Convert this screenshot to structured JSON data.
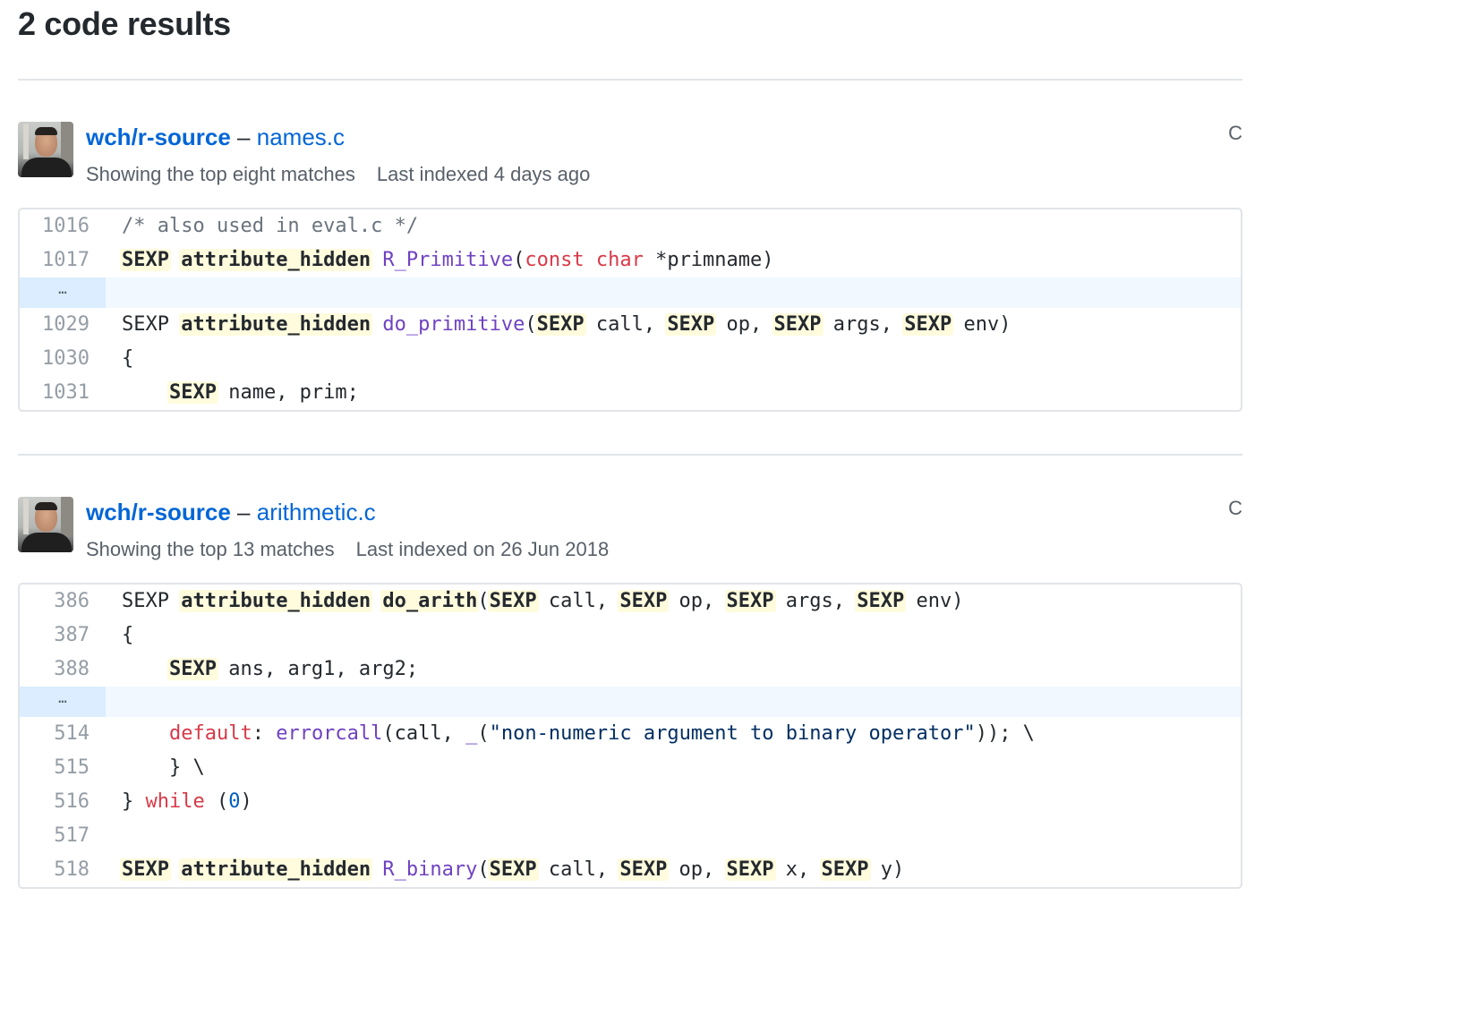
{
  "page": {
    "title": "2 code results"
  },
  "results": [
    {
      "repo": "wch/r-source",
      "separator": " – ",
      "file": "names.c",
      "language": "C",
      "matches_text": "Showing the top eight matches",
      "indexed_text": "Last indexed 4 days ago",
      "lines": [
        {
          "num": "1016",
          "tokens": [
            {
              "t": "/* also used in eval.c */",
              "c": "cm"
            }
          ]
        },
        {
          "num": "1017",
          "tokens": [
            {
              "t": "SEXP",
              "c": "hl"
            },
            {
              "t": " ",
              "c": ""
            },
            {
              "t": "attribute_hidden",
              "c": "hl"
            },
            {
              "t": " ",
              "c": ""
            },
            {
              "t": "R_Primitive",
              "c": "en"
            },
            {
              "t": "(",
              "c": ""
            },
            {
              "t": "const",
              "c": "k"
            },
            {
              "t": " ",
              "c": ""
            },
            {
              "t": "char",
              "c": "k"
            },
            {
              "t": " *primname)",
              "c": ""
            }
          ]
        },
        {
          "expander": true,
          "symbol": "…"
        },
        {
          "num": "1029",
          "tokens": [
            {
              "t": "SEXP ",
              "c": ""
            },
            {
              "t": "attribute_hidden",
              "c": "hl"
            },
            {
              "t": " ",
              "c": ""
            },
            {
              "t": "do_primitive",
              "c": "en"
            },
            {
              "t": "(",
              "c": ""
            },
            {
              "t": "SEXP",
              "c": "hl"
            },
            {
              "t": " call, ",
              "c": ""
            },
            {
              "t": "SEXP",
              "c": "hl"
            },
            {
              "t": " op, ",
              "c": ""
            },
            {
              "t": "SEXP",
              "c": "hl"
            },
            {
              "t": " args, ",
              "c": ""
            },
            {
              "t": "SEXP",
              "c": "hl"
            },
            {
              "t": " env)",
              "c": ""
            }
          ]
        },
        {
          "num": "1030",
          "tokens": [
            {
              "t": "{",
              "c": ""
            }
          ]
        },
        {
          "num": "1031",
          "tokens": [
            {
              "t": "    ",
              "c": ""
            },
            {
              "t": "SEXP",
              "c": "hl"
            },
            {
              "t": " name, prim;",
              "c": ""
            }
          ]
        }
      ]
    },
    {
      "repo": "wch/r-source",
      "separator": " – ",
      "file": "arithmetic.c",
      "language": "C",
      "matches_text": "Showing the top 13 matches",
      "indexed_text": "Last indexed on 26 Jun 2018",
      "lines": [
        {
          "num": "386",
          "tokens": [
            {
              "t": "SEXP ",
              "c": ""
            },
            {
              "t": "attribute_hidden",
              "c": "hl"
            },
            {
              "t": " ",
              "c": ""
            },
            {
              "t": "do_arith",
              "c": "hl"
            },
            {
              "t": "(",
              "c": ""
            },
            {
              "t": "SEXP",
              "c": "hl"
            },
            {
              "t": " call, ",
              "c": ""
            },
            {
              "t": "SEXP",
              "c": "hl"
            },
            {
              "t": " op, ",
              "c": ""
            },
            {
              "t": "SEXP",
              "c": "hl"
            },
            {
              "t": " args, ",
              "c": ""
            },
            {
              "t": "SEXP",
              "c": "hl"
            },
            {
              "t": " env)",
              "c": ""
            }
          ]
        },
        {
          "num": "387",
          "tokens": [
            {
              "t": "{",
              "c": ""
            }
          ]
        },
        {
          "num": "388",
          "tokens": [
            {
              "t": "    ",
              "c": ""
            },
            {
              "t": "SEXP",
              "c": "hl"
            },
            {
              "t": " ans, arg1, arg2;",
              "c": ""
            }
          ]
        },
        {
          "expander": true,
          "symbol": "…"
        },
        {
          "num": "514",
          "tokens": [
            {
              "t": "    ",
              "c": ""
            },
            {
              "t": "default",
              "c": "k"
            },
            {
              "t": ": ",
              "c": ""
            },
            {
              "t": "errorcall",
              "c": "en"
            },
            {
              "t": "(call, ",
              "c": ""
            },
            {
              "t": "_",
              "c": "en"
            },
            {
              "t": "(",
              "c": ""
            },
            {
              "t": "\"non-numeric argument to binary operator\"",
              "c": "s"
            },
            {
              "t": ")); \\",
              "c": ""
            }
          ]
        },
        {
          "num": "515",
          "tokens": [
            {
              "t": "    } \\",
              "c": ""
            }
          ]
        },
        {
          "num": "516",
          "tokens": [
            {
              "t": "} ",
              "c": ""
            },
            {
              "t": "while",
              "c": "k"
            },
            {
              "t": " (",
              "c": ""
            },
            {
              "t": "0",
              "c": "c1"
            },
            {
              "t": ")",
              "c": ""
            }
          ]
        },
        {
          "num": "517",
          "tokens": []
        },
        {
          "num": "518",
          "tokens": [
            {
              "t": "SEXP",
              "c": "hl"
            },
            {
              "t": " ",
              "c": ""
            },
            {
              "t": "attribute_hidden",
              "c": "hl"
            },
            {
              "t": " ",
              "c": ""
            },
            {
              "t": "R_binary",
              "c": "en"
            },
            {
              "t": "(",
              "c": ""
            },
            {
              "t": "SEXP",
              "c": "hl"
            },
            {
              "t": " call, ",
              "c": ""
            },
            {
              "t": "SEXP",
              "c": "hl"
            },
            {
              "t": " op, ",
              "c": ""
            },
            {
              "t": "SEXP",
              "c": "hl"
            },
            {
              "t": " x, ",
              "c": ""
            },
            {
              "t": "SEXP",
              "c": "hl"
            },
            {
              "t": " y)",
              "c": ""
            }
          ]
        }
      ]
    }
  ],
  "colors": {
    "link": "#0366d6",
    "highlight": "#fffbdd",
    "keyword": "#d73a49",
    "entity": "#6f42c1",
    "comment": "#6a737d",
    "string": "#032f62",
    "constant": "#005cc5",
    "expander": "#f1f8ff"
  }
}
